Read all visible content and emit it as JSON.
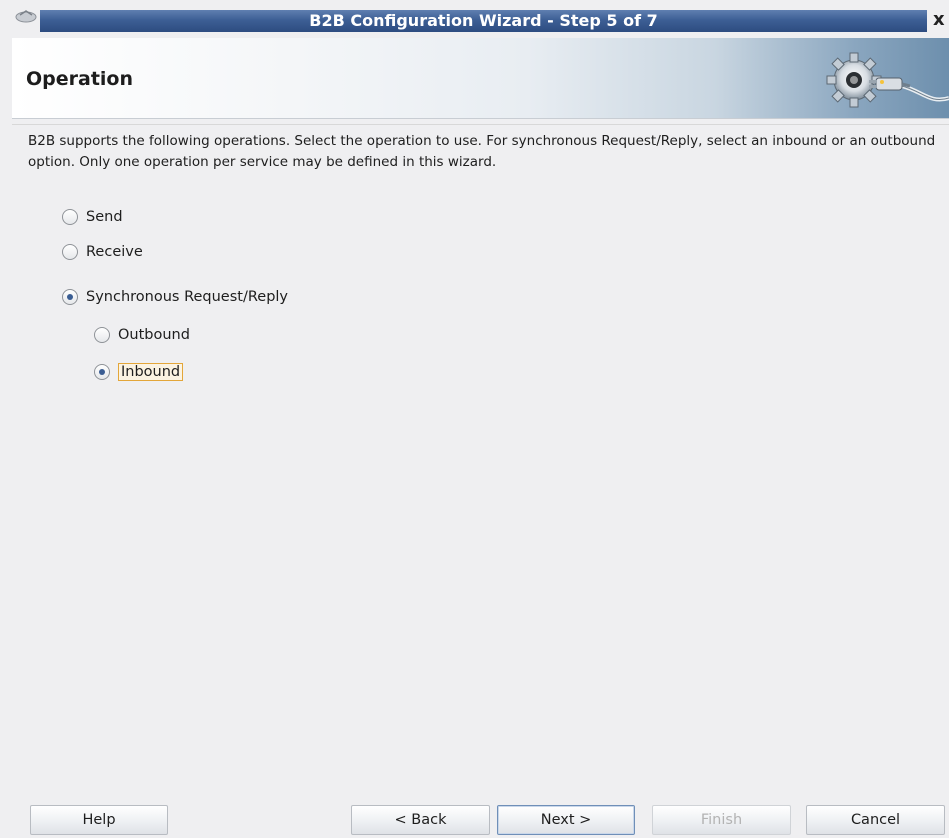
{
  "window": {
    "title": "B2B Configuration Wizard - Step 5 of 7",
    "close_glyph": "x"
  },
  "header": {
    "title": "Operation"
  },
  "description": "B2B supports the following operations.  Select the operation to use.  For synchronous Request/Reply, select an inbound or an outbound option. Only one operation per service may be defined in this wizard.",
  "options": {
    "send": {
      "label": "Send",
      "selected": false
    },
    "receive": {
      "label": "Receive",
      "selected": false
    },
    "sync": {
      "label": "Synchronous Request/Reply",
      "selected": true
    },
    "outbound": {
      "label": "Outbound",
      "selected": false
    },
    "inbound": {
      "label": "Inbound",
      "selected": true
    }
  },
  "buttons": {
    "help": "Help",
    "back": "< Back",
    "next": "Next >",
    "finish": "Finish",
    "cancel": "Cancel"
  },
  "icons": {
    "window_icon": "window-menu-icon",
    "banner_art": "gear-plug-icon"
  },
  "colors": {
    "titlebar": "#3d5f95",
    "focus_border": "#e3a63a",
    "radio_dot": "#3a5d93"
  }
}
